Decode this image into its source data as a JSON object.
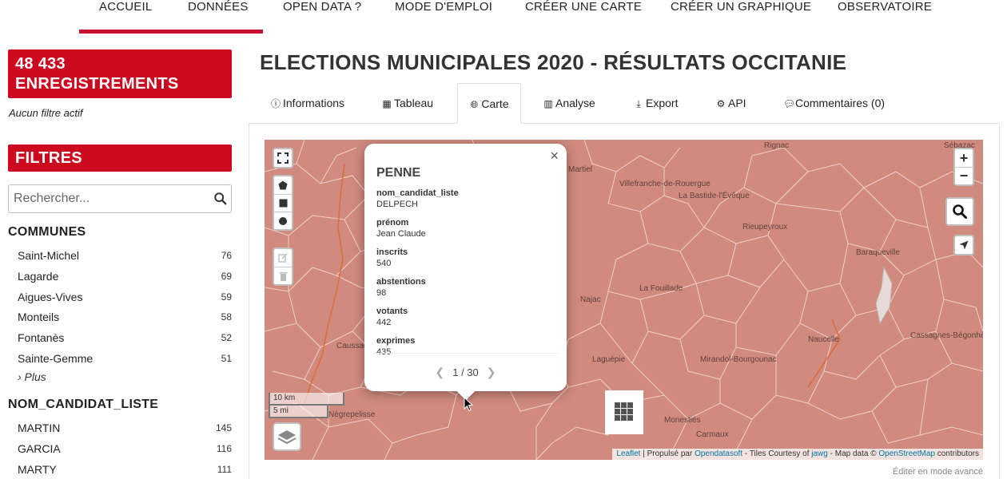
{
  "nav": {
    "items": [
      "ACCUEIL",
      "DONNÉES",
      "OPEN DATA ?",
      "MODE D'EMPLOI",
      "CRÉER UNE CARTE",
      "CRÉER UN GRAPHIQUE",
      "OBSERVATOIRE"
    ],
    "active": "DONNÉES"
  },
  "sidebar": {
    "count_line1": "48 433",
    "count_line2": "ENREGISTREMENTS",
    "no_filter": "Aucun filtre actif",
    "filters_title": "FILTRES",
    "search_placeholder": "Rechercher...",
    "facets": [
      {
        "title": "COMMUNES",
        "items": [
          {
            "label": "Saint-Michel",
            "count": "76"
          },
          {
            "label": "Lagarde",
            "count": "69"
          },
          {
            "label": "Aigues-Vives",
            "count": "59"
          },
          {
            "label": "Monteils",
            "count": "58"
          },
          {
            "label": "Fontanès",
            "count": "52"
          },
          {
            "label": "Sainte-Gemme",
            "count": "51"
          }
        ],
        "more": "› Plus"
      },
      {
        "title": "NOM_CANDIDAT_LISTE",
        "items": [
          {
            "label": "MARTIN",
            "count": "145"
          },
          {
            "label": "GARCIA",
            "count": "116"
          },
          {
            "label": "MARTY",
            "count": "111"
          }
        ]
      }
    ]
  },
  "main": {
    "title": "ELECTIONS MUNICIPALES 2020 - RÉSULTATS OCCITANIE",
    "tabs": [
      {
        "label": "Informations",
        "icon": "info-icon"
      },
      {
        "label": "Tableau",
        "icon": "table-icon"
      },
      {
        "label": "Carte",
        "icon": "globe-icon",
        "active": true
      },
      {
        "label": "Analyse",
        "icon": "bar-chart-icon"
      },
      {
        "label": "Export",
        "icon": "download-icon"
      },
      {
        "label": "API",
        "icon": "cogs-icon"
      },
      {
        "label": "Commentaires (0)",
        "icon": "comments-icon"
      }
    ],
    "footnote": "Éditer en mode avancé"
  },
  "map": {
    "fill_color": "#d08a7e",
    "places": [
      "Villefranche-de-Rouergue",
      "La Bastide-l'Évêque",
      "Rieupeyroux",
      "Naucelle",
      "La Fouillade",
      "Cassagnes-Bégonhès",
      "Mirandol-Bourgounac",
      "Monestiés",
      "Carmaux",
      "Laguépie",
      "Caussade",
      "Nègrepelisse",
      "Martiel",
      "Najac",
      "Baraqueville",
      "Rignac",
      "Sébazac"
    ],
    "zoom_in": "+",
    "zoom_out": "−",
    "scale_km": "10 km",
    "scale_mi": "5 mi",
    "attribution": {
      "leaflet": "Leaflet",
      "powered": "| Propulsé par",
      "ods": "Opendatasoft",
      "tiles": "- Tiles Courtesy of",
      "jawg": "jawg",
      "mapdata": "- Map data ©",
      "osm": "OpenStreetMap",
      "contrib": "contributors"
    },
    "popup": {
      "title": "PENNE",
      "fields": [
        {
          "key": "nom_candidat_liste",
          "value": "DELPECH"
        },
        {
          "key": "prénom",
          "value": "Jean Claude"
        },
        {
          "key": "inscrits",
          "value": "540"
        },
        {
          "key": "abstentions",
          "value": "98"
        },
        {
          "key": "votants",
          "value": "442"
        },
        {
          "key": "exprimes",
          "value": "435"
        }
      ],
      "pager": "1 / 30",
      "close": "×"
    }
  }
}
